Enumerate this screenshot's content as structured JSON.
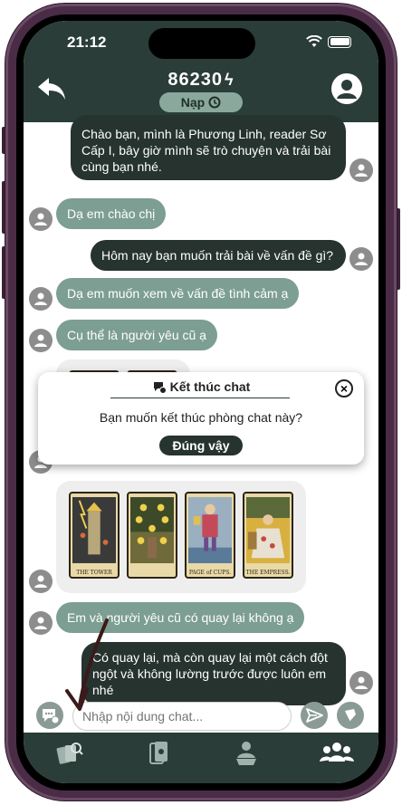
{
  "status_bar": {
    "time": "21:12"
  },
  "header": {
    "credit": "86230",
    "topup_label": "Nạp"
  },
  "messages": {
    "m1": "Chào bạn, mình là Phương Linh, reader Sơ Cấp I, bây giờ mình sẽ trò chuyện và trải bài cùng bạn nhé.",
    "m2": "Dạ em chào chị",
    "m3": "Hôm nay bạn muốn trải bài về vấn đề gì?",
    "m4": "Dạ em muốn xem về vấn đề tình cảm ạ",
    "m5": "Cụ thể là người yêu cũ ạ",
    "m6": "Em và người yêu cũ có quay lại không ạ",
    "m7": "Có quay lại, mà còn quay lại một cách đột ngột và không lường trước được luôn em nhé"
  },
  "cards": [
    {
      "name": "THE TOWER"
    },
    {
      "name": ""
    },
    {
      "name": "PAGE of CUPS."
    },
    {
      "name": "THE EMPRESS."
    }
  ],
  "dialog": {
    "title": "Kết thúc chat",
    "message": "Bạn muốn kết thúc phòng chat này?",
    "confirm": "Đúng vậy"
  },
  "input": {
    "placeholder": "Nhập nội dung chat..."
  },
  "colors": {
    "header_bg": "#2a3d38",
    "outgoing_bubble": "#26332f",
    "incoming_bubble": "#7d9e92",
    "accent": "#8aa89c"
  },
  "nav_icons": [
    "cards-search-icon",
    "card-deck-icon",
    "reader-icon",
    "community-icon"
  ]
}
